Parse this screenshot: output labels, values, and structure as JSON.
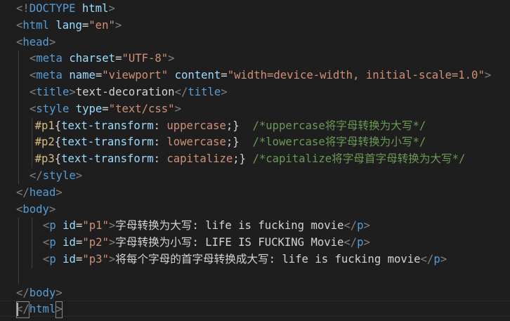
{
  "editor": {
    "lines": [
      {
        "indent": 0,
        "tokens": [
          [
            "tag-punct",
            "<!"
          ],
          [
            "tag-name",
            "DOCTYPE"
          ],
          [
            "txt",
            " "
          ],
          [
            "attr",
            "html"
          ],
          [
            "tag-punct",
            ">"
          ]
        ]
      },
      {
        "indent": 0,
        "tokens": [
          [
            "tag-punct",
            "<"
          ],
          [
            "tag-name",
            "html"
          ],
          [
            "txt",
            " "
          ],
          [
            "attr",
            "lang"
          ],
          [
            "eq",
            "="
          ],
          [
            "str",
            "\"en\""
          ],
          [
            "tag-punct",
            ">"
          ]
        ]
      },
      {
        "indent": 0,
        "tokens": [
          [
            "tag-punct",
            "<"
          ],
          [
            "tag-name",
            "head"
          ],
          [
            "tag-punct",
            ">"
          ]
        ]
      },
      {
        "indent": 1,
        "tokens": [
          [
            "tag-punct",
            "<"
          ],
          [
            "tag-name",
            "meta"
          ],
          [
            "txt",
            " "
          ],
          [
            "attr",
            "charset"
          ],
          [
            "eq",
            "="
          ],
          [
            "str",
            "\"UTF-8\""
          ],
          [
            "tag-punct",
            ">"
          ]
        ]
      },
      {
        "indent": 1,
        "tokens": [
          [
            "tag-punct",
            "<"
          ],
          [
            "tag-name",
            "meta"
          ],
          [
            "txt",
            " "
          ],
          [
            "attr",
            "name"
          ],
          [
            "eq",
            "="
          ],
          [
            "str",
            "\"viewport\""
          ],
          [
            "txt",
            " "
          ],
          [
            "attr",
            "content"
          ],
          [
            "eq",
            "="
          ],
          [
            "str",
            "\"width=device-width, initial-scale=1.0\""
          ],
          [
            "tag-punct",
            ">"
          ]
        ]
      },
      {
        "indent": 1,
        "tokens": [
          [
            "tag-punct",
            "<"
          ],
          [
            "tag-name",
            "title"
          ],
          [
            "tag-punct",
            ">"
          ],
          [
            "txt",
            "text-decoration"
          ],
          [
            "tag-punct",
            "</"
          ],
          [
            "tag-name",
            "title"
          ],
          [
            "tag-punct",
            ">"
          ]
        ]
      },
      {
        "indent": 1,
        "tokens": [
          [
            "tag-punct",
            "<"
          ],
          [
            "tag-name",
            "style"
          ],
          [
            "txt",
            " "
          ],
          [
            "attr",
            "type"
          ],
          [
            "eq",
            "="
          ],
          [
            "str",
            "\"text/css\""
          ],
          [
            "tag-punct",
            ">"
          ]
        ]
      },
      {
        "indent": 1.4,
        "tokens": [
          [
            "sel",
            "#p1"
          ],
          [
            "brace",
            "{"
          ],
          [
            "prop",
            "text-transform"
          ],
          [
            "txt",
            ": "
          ],
          [
            "val",
            "uppercase"
          ],
          [
            "brace",
            ";}"
          ],
          [
            "txt",
            "  "
          ],
          [
            "comment",
            "/*uppercase将字母转换为大写*/"
          ]
        ]
      },
      {
        "indent": 1.4,
        "tokens": [
          [
            "sel",
            "#p2"
          ],
          [
            "brace",
            "{"
          ],
          [
            "prop",
            "text-transform"
          ],
          [
            "txt",
            ": "
          ],
          [
            "val",
            "lowercase"
          ],
          [
            "brace",
            ";}"
          ],
          [
            "txt",
            "  "
          ],
          [
            "comment",
            "/*lowercase将字母转换为小写*/"
          ]
        ]
      },
      {
        "indent": 1.4,
        "tokens": [
          [
            "sel",
            "#p3"
          ],
          [
            "brace",
            "{"
          ],
          [
            "prop",
            "text-transform"
          ],
          [
            "txt",
            ": "
          ],
          [
            "val",
            "capitalize"
          ],
          [
            "brace",
            ";}"
          ],
          [
            "txt",
            " "
          ],
          [
            "comment",
            "/*capitalize将字母首字母转换为大写*/"
          ]
        ]
      },
      {
        "indent": 1,
        "tokens": [
          [
            "tag-punct",
            "</"
          ],
          [
            "tag-name",
            "style"
          ],
          [
            "tag-punct",
            ">"
          ]
        ]
      },
      {
        "indent": 0,
        "tokens": [
          [
            "tag-punct",
            "</"
          ],
          [
            "tag-name",
            "head"
          ],
          [
            "tag-punct",
            ">"
          ]
        ]
      },
      {
        "indent": 0,
        "tokens": [
          [
            "tag-punct",
            "<"
          ],
          [
            "tag-name",
            "body"
          ],
          [
            "tag-punct",
            ">"
          ]
        ]
      },
      {
        "indent": 2,
        "tokens": [
          [
            "tag-punct",
            "<"
          ],
          [
            "tag-name",
            "p"
          ],
          [
            "txt",
            " "
          ],
          [
            "attr",
            "id"
          ],
          [
            "eq",
            "="
          ],
          [
            "str",
            "\"p1\""
          ],
          [
            "tag-punct",
            ">"
          ],
          [
            "txt",
            "字母转换为大写: life is fucking movie"
          ],
          [
            "tag-punct",
            "</"
          ],
          [
            "tag-name",
            "p"
          ],
          [
            "tag-punct",
            ">"
          ]
        ]
      },
      {
        "indent": 2,
        "tokens": [
          [
            "tag-punct",
            "<"
          ],
          [
            "tag-name",
            "p"
          ],
          [
            "txt",
            " "
          ],
          [
            "attr",
            "id"
          ],
          [
            "eq",
            "="
          ],
          [
            "str",
            "\"p2\""
          ],
          [
            "tag-punct",
            ">"
          ],
          [
            "txt",
            "字母转换为小写: LIFE IS FUCKING Movie"
          ],
          [
            "tag-punct",
            "</"
          ],
          [
            "tag-name",
            "p"
          ],
          [
            "tag-punct",
            ">"
          ]
        ]
      },
      {
        "indent": 2,
        "tokens": [
          [
            "tag-punct",
            "<"
          ],
          [
            "tag-name",
            "p"
          ],
          [
            "txt",
            " "
          ],
          [
            "attr",
            "id"
          ],
          [
            "eq",
            "="
          ],
          [
            "str",
            "\"p3\""
          ],
          [
            "tag-punct",
            ">"
          ],
          [
            "txt",
            "将每个字母的首字母转换成大写: life is fucking movie"
          ],
          [
            "tag-punct",
            "</"
          ],
          [
            "tag-name",
            "p"
          ],
          [
            "tag-punct",
            ">"
          ]
        ]
      },
      {
        "indent": 0,
        "tokens": []
      },
      {
        "indent": 0,
        "tokens": [
          [
            "tag-punct",
            "</"
          ],
          [
            "tag-name",
            "body"
          ],
          [
            "tag-punct",
            ">"
          ]
        ]
      },
      {
        "indent": 0,
        "tokens": [
          [
            "tag-punct",
            "</"
          ],
          [
            "tag-name",
            "html"
          ],
          [
            "tag-punct",
            ">"
          ]
        ]
      }
    ]
  }
}
